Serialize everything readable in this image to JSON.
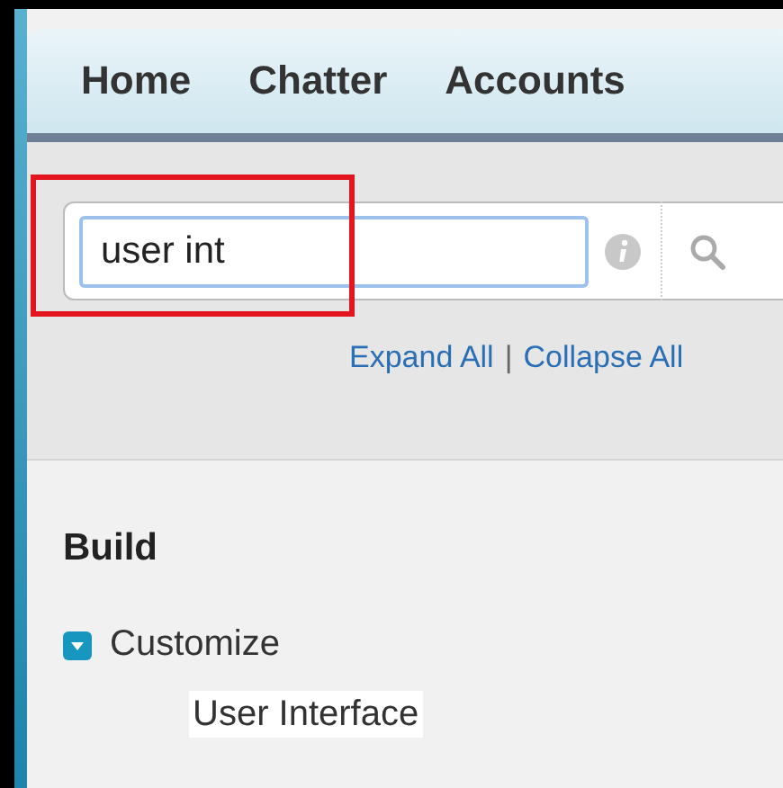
{
  "tabs": [
    {
      "label": "Home",
      "selected": false
    },
    {
      "label": "Chatter",
      "selected": false
    },
    {
      "label": "Accounts",
      "selected": false
    }
  ],
  "search": {
    "value": "user int"
  },
  "tree_links": {
    "items": [
      "Expand All",
      "Collapse All"
    ],
    "separator": "|"
  },
  "sections": [
    {
      "title": "Build",
      "items": [
        {
          "label": "Customize",
          "expanded": true,
          "children": [
            {
              "label": "User Interface",
              "highlighted": true
            }
          ]
        }
      ]
    }
  ]
}
